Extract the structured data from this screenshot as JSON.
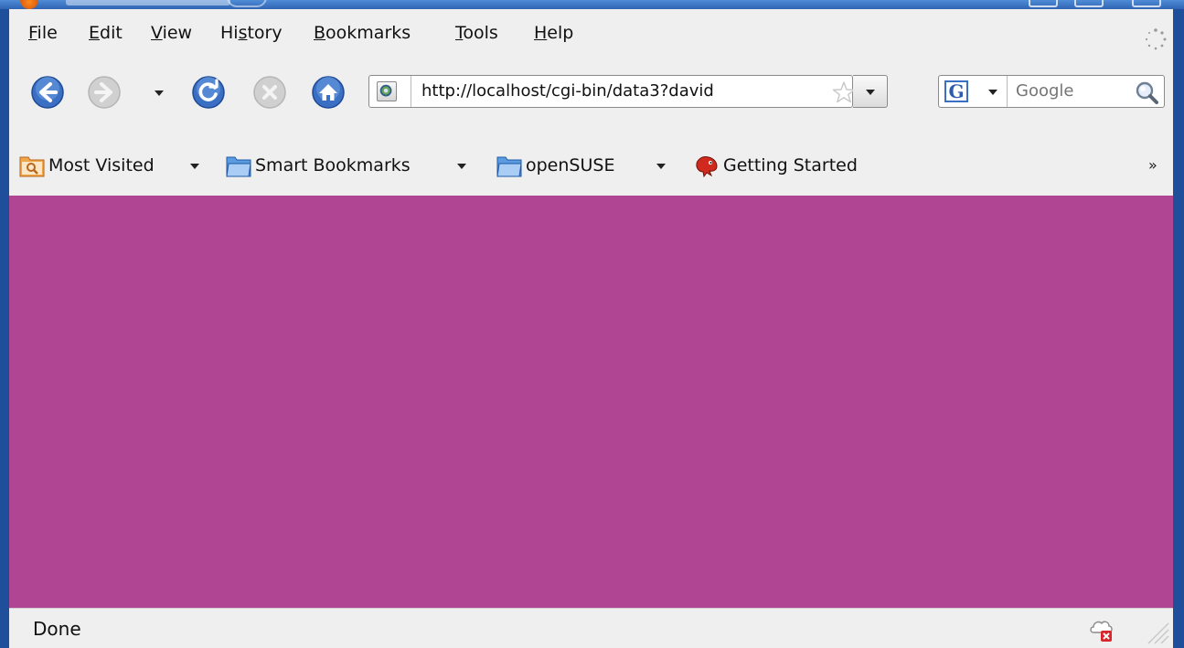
{
  "menu": {
    "file": {
      "accel": "F",
      "rest": "ile"
    },
    "edit": {
      "accel": "E",
      "rest": "dit"
    },
    "view": {
      "accel": "V",
      "rest": "iew"
    },
    "history": {
      "pre": "Hi",
      "accel": "s",
      "rest": "tory"
    },
    "bookmarks": {
      "accel": "B",
      "rest": "ookmarks"
    },
    "tools": {
      "accel": "T",
      "rest": "ools"
    },
    "help": {
      "accel": "H",
      "rest": "elp"
    }
  },
  "navigation": {
    "url": "http://localhost/cgi-bin/data3?david",
    "search_placeholder": "Google",
    "search_engine_letter": "G"
  },
  "bookmarks": [
    {
      "label": "Most Visited",
      "icon": "smart-folder-icon",
      "has_dropdown": true
    },
    {
      "label": "Smart Bookmarks",
      "icon": "folder-icon",
      "has_dropdown": true
    },
    {
      "label": "openSUSE",
      "icon": "folder-icon",
      "has_dropdown": true
    },
    {
      "label": "Getting Started",
      "icon": "opensuse-gecko-icon",
      "has_dropdown": false
    }
  ],
  "bookmarks_overflow": "»",
  "content": {
    "background_color": "#b04593"
  },
  "status": {
    "text": "Done"
  },
  "colors": {
    "accent": "#3a6fc4",
    "chrome": "#efefef",
    "frame": "#1f4e9a"
  }
}
